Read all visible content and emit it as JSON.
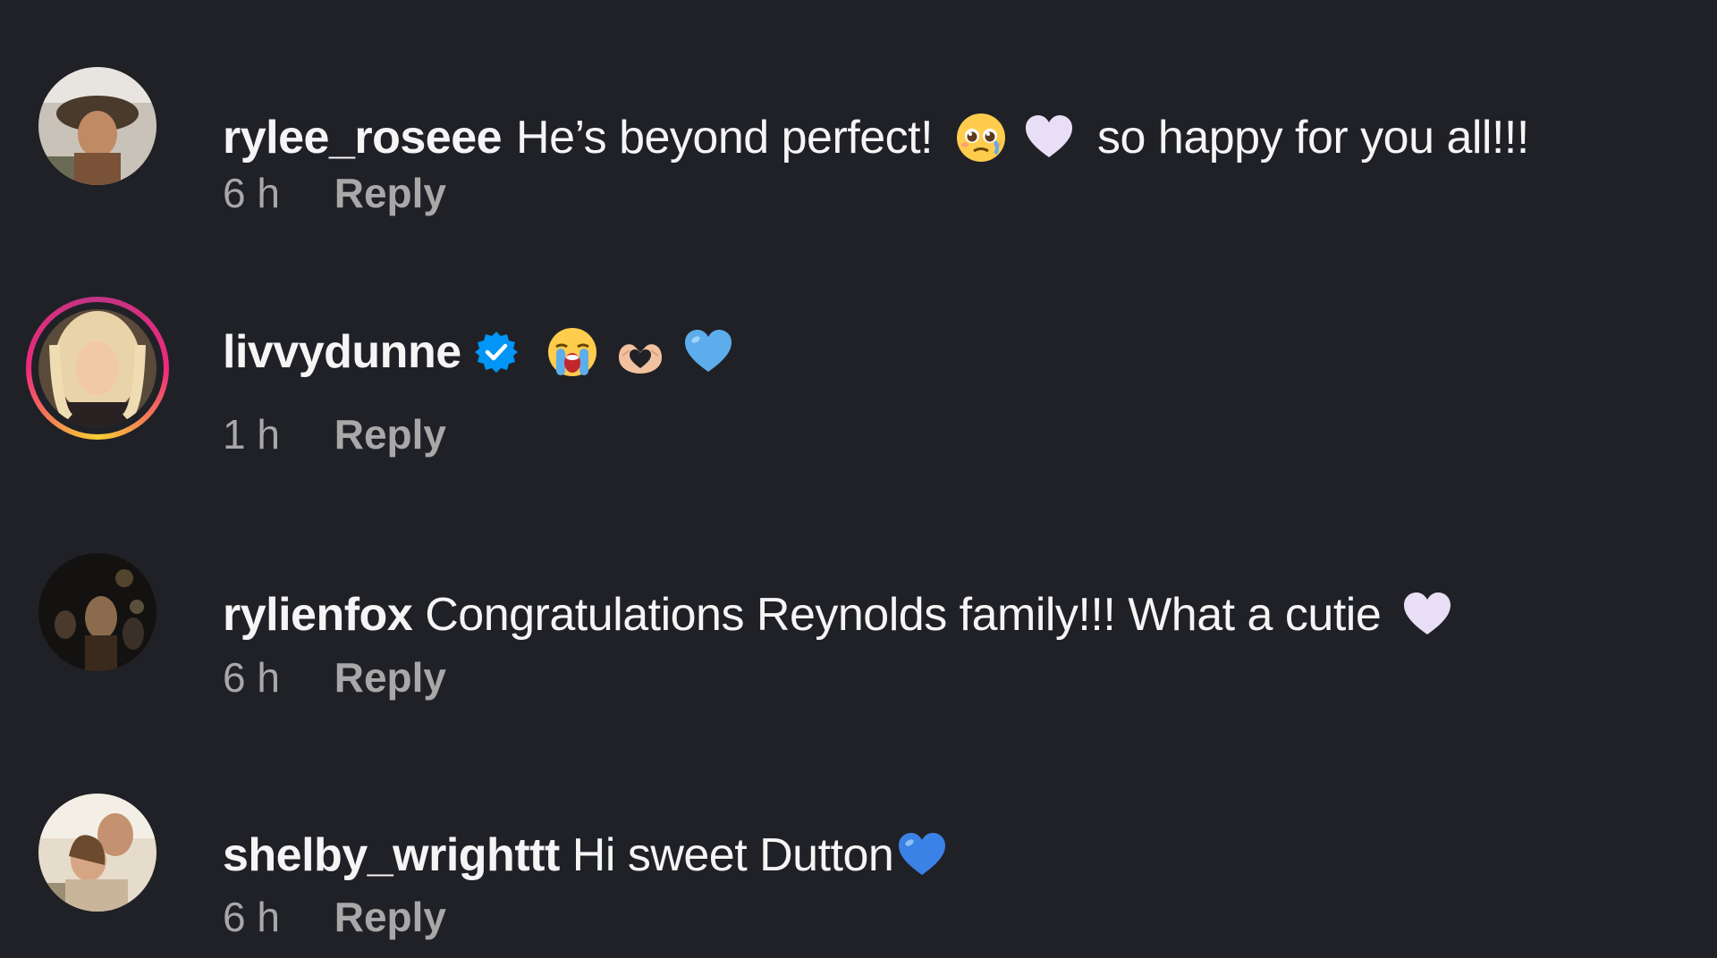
{
  "comments": [
    {
      "username": "rylee_roseee",
      "text_before": "He’s beyond perfect!",
      "text_after": "so happy for you all!!!",
      "time": "6 h",
      "reply_label": "Reply",
      "emojis": [
        "pleading-face-icon",
        "white-heart-icon"
      ]
    },
    {
      "username": "livvydunne",
      "verified": true,
      "time": "1 h",
      "reply_label": "Reply",
      "emojis": [
        "loudly-crying-face-icon",
        "heart-hands-icon",
        "blue-heart-icon"
      ]
    },
    {
      "username": "rylienfox",
      "text_before": "Congratulations Reynolds family!!! What a cutie",
      "time": "6 h",
      "reply_label": "Reply",
      "emojis": [
        "white-heart-icon"
      ]
    },
    {
      "username": "shelby_wrighttt",
      "text_before": "Hi sweet Dutton",
      "time": "6 h",
      "reply_label": "Reply",
      "emojis": [
        "blue-heart-icon"
      ]
    }
  ],
  "colors": {
    "background": "#202127",
    "text": "#f5f5f5",
    "meta": "#a8a8a8",
    "verified": "#0095f6"
  }
}
